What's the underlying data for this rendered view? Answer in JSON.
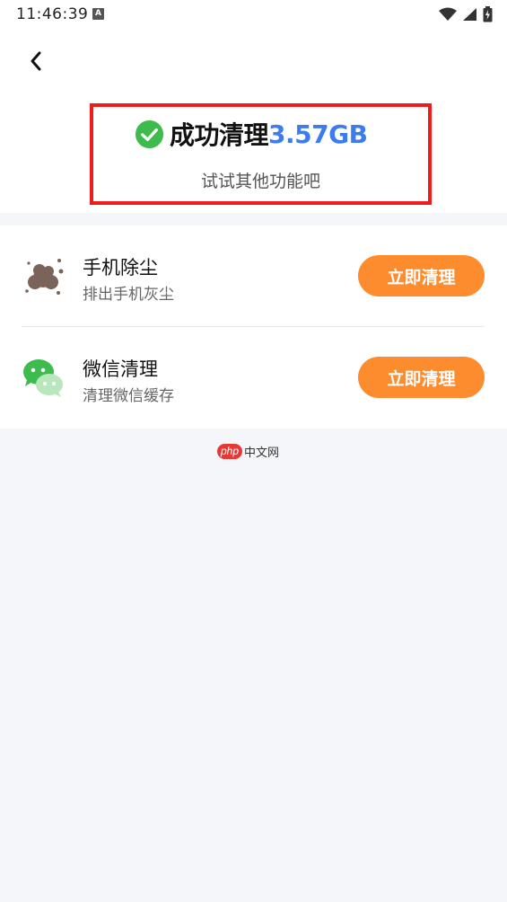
{
  "status_bar": {
    "time": "11:46:39",
    "notification_badge": "A"
  },
  "header": {
    "back_icon": "chevron-left-icon"
  },
  "result": {
    "icon": "check-circle-icon",
    "icon_color": "#3dbb4c",
    "title": "成功清理",
    "size": "3.57GB",
    "size_color": "#3d7cf0",
    "subtitle": "试试其他功能吧"
  },
  "features": [
    {
      "icon": "dust-icon",
      "title": "手机除尘",
      "description": "排出手机灰尘",
      "button_label": "立即清理"
    },
    {
      "icon": "wechat-icon",
      "title": "微信清理",
      "description": "清理微信缓存",
      "button_label": "立即清理"
    }
  ],
  "watermark": {
    "brand": "php",
    "text": "中文网"
  },
  "colors": {
    "accent": "#fd8c2e",
    "highlight_border": "#ee1c1c",
    "page_bg": "#f5f6fa"
  }
}
